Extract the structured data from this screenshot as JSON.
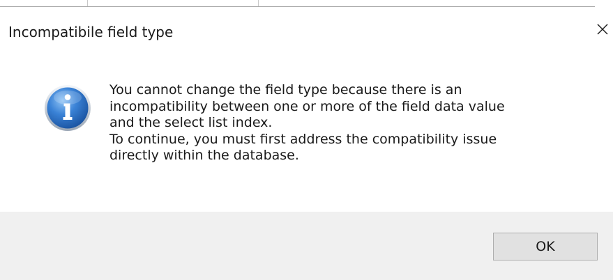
{
  "dialog": {
    "title": "Incompatibile field type",
    "close_icon": "close-x-icon",
    "icon": "information-icon",
    "message_lines": [
      "You cannot change the field type because there is an",
      "incompatibility between one or more of the field data value",
      "and the select list index.",
      "To continue, you must first address the compatibility issue",
      "directly within the database."
    ],
    "ok_label": "OK"
  },
  "colors": {
    "background": "#ffffff",
    "footer": "#f0f0f0",
    "button_face": "#e1e1e1",
    "button_border": "#adadad",
    "icon_blue": "#1f5fae"
  }
}
